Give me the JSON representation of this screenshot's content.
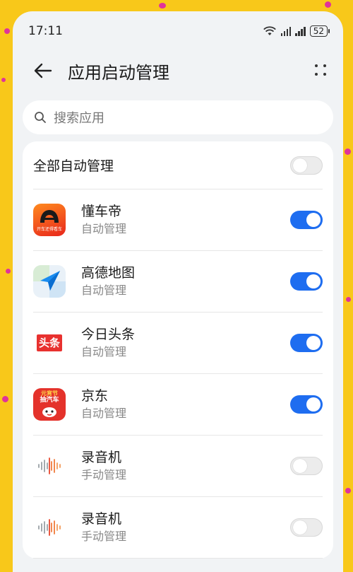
{
  "status_bar": {
    "time": "17:11",
    "battery": "52"
  },
  "header": {
    "title": "应用启动管理"
  },
  "search": {
    "placeholder": "搜索应用"
  },
  "all_toggle": {
    "label": "全部自动管理",
    "state": "off"
  },
  "apps": [
    {
      "name": "懂车帝",
      "mode": "自动管理",
      "toggle": "on",
      "icon": "dongchedi-icon",
      "icon_caption": "开车还得看车"
    },
    {
      "name": "高德地图",
      "mode": "自动管理",
      "toggle": "on",
      "icon": "amap-icon"
    },
    {
      "name": "今日头条",
      "mode": "自动管理",
      "toggle": "on",
      "icon": "toutiao-icon",
      "icon_text": "头条"
    },
    {
      "name": "京东",
      "mode": "自动管理",
      "toggle": "on",
      "icon": "jd-icon",
      "icon_text_top": "元宵节",
      "icon_text_mid": "抽汽车"
    },
    {
      "name": "录音机",
      "mode": "手动管理",
      "toggle": "off",
      "icon": "recorder-icon"
    },
    {
      "name": "录音机",
      "mode": "手动管理",
      "toggle": "off",
      "icon": "recorder-icon"
    }
  ],
  "colors": {
    "toggle_on": "#1e6df0",
    "background": "#f8c81a",
    "dots": "#e0339a"
  }
}
